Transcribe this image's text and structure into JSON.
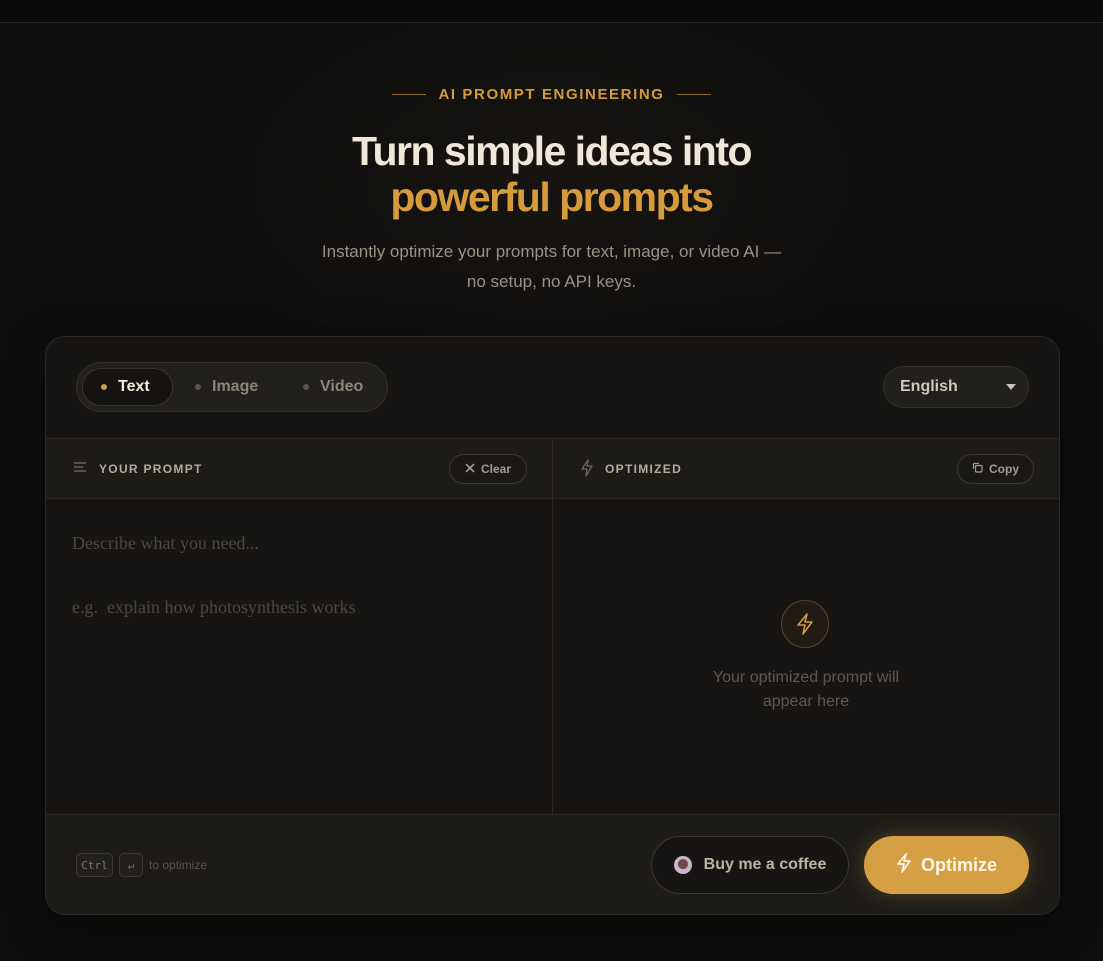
{
  "hero": {
    "eyebrow": "AI PROMPT ENGINEERING",
    "headline_line1": "Turn simple ideas into",
    "headline_line2": "powerful prompts",
    "subtitle_line1": "Instantly optimize your prompts for text, image, or video AI —",
    "subtitle_line2": "no setup, no API keys."
  },
  "mode_tabs": [
    {
      "label": "Text",
      "active": true
    },
    {
      "label": "Image",
      "active": false
    },
    {
      "label": "Video",
      "active": false
    }
  ],
  "language": {
    "selected": "English"
  },
  "prompt_panel": {
    "label": "YOUR PROMPT",
    "clear_label": "Clear",
    "placeholder": "Describe what you need...\n\ne.g.  explain how photosynthesis works",
    "value": ""
  },
  "output_panel": {
    "label": "OPTIMIZED",
    "copy_label": "Copy",
    "empty_line1": "Your optimized prompt will",
    "empty_line2": "appear here"
  },
  "footer": {
    "kbd_ctrl": "Ctrl",
    "kbd_enter": "↵",
    "hint": "to optimize",
    "coffee_label": "Buy me a coffee",
    "optimize_label": "Optimize"
  },
  "colors": {
    "accent": "#d4a043",
    "background": "#0f0e0d",
    "card": "#161514"
  },
  "icons": [
    "lines-icon",
    "close-icon",
    "bolt-icon",
    "copy-icon",
    "coffee-icon",
    "caret-down-icon"
  ]
}
